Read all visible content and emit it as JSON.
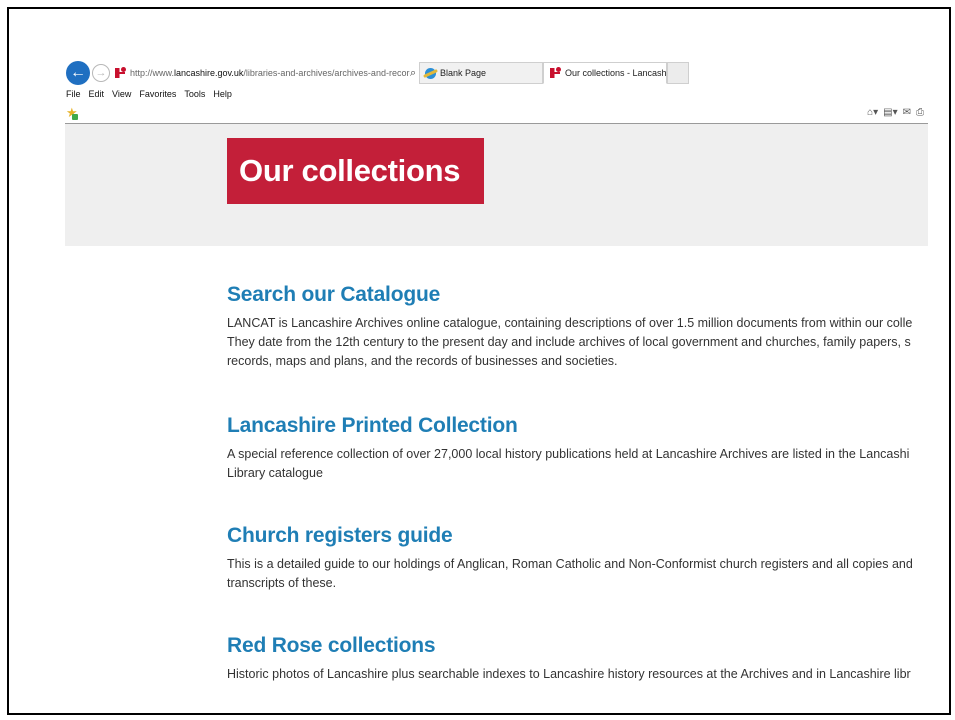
{
  "browser": {
    "address": {
      "url_prefix": "http://www.",
      "url_domain": "lancashire.gov.uk",
      "url_path": "/libraries-and-archives/archives-and-recorc",
      "controls": [
        "⌕",
        "▾",
        "↻"
      ]
    },
    "tabs": [
      {
        "label": "Blank Page"
      },
      {
        "label": "Our collections - Lancashire...",
        "close": "×"
      }
    ],
    "menu": [
      "File",
      "Edit",
      "View",
      "Favorites",
      "Tools",
      "Help"
    ],
    "command_icons": [
      "home-icon",
      "rss-icon",
      "mail-icon",
      "print-icon"
    ]
  },
  "page": {
    "hero_title": "Our collections",
    "sections": [
      {
        "heading": "Search our Catalogue",
        "lines": [
          "LANCAT is Lancashire Archives online catalogue, containing descriptions of over 1.5 million documents from within our colle",
          "They date from the 12th century to the present day and include archives of local government and churches, family papers, s",
          "records, maps and plans, and the records of businesses and societies."
        ]
      },
      {
        "heading": "Lancashire Printed Collection",
        "lines": [
          "A special reference collection of over 27,000 local history publications held at Lancashire Archives are listed in the Lancashi",
          "Library catalogue"
        ]
      },
      {
        "heading": "Church registers guide",
        "lines": [
          "This is a detailed guide to our holdings of Anglican, Roman Catholic and Non-Conformist church registers and all copies and",
          "transcripts of these."
        ]
      },
      {
        "heading": "Red Rose collections",
        "lines": [
          "Historic photos of Lancashire plus searchable indexes to Lancashire history resources at the Archives and in Lancashire libr"
        ]
      }
    ]
  },
  "colors": {
    "hero_bg": "#c31f39",
    "heading": "#1f7eb5",
    "hero_band": "#efefef"
  }
}
